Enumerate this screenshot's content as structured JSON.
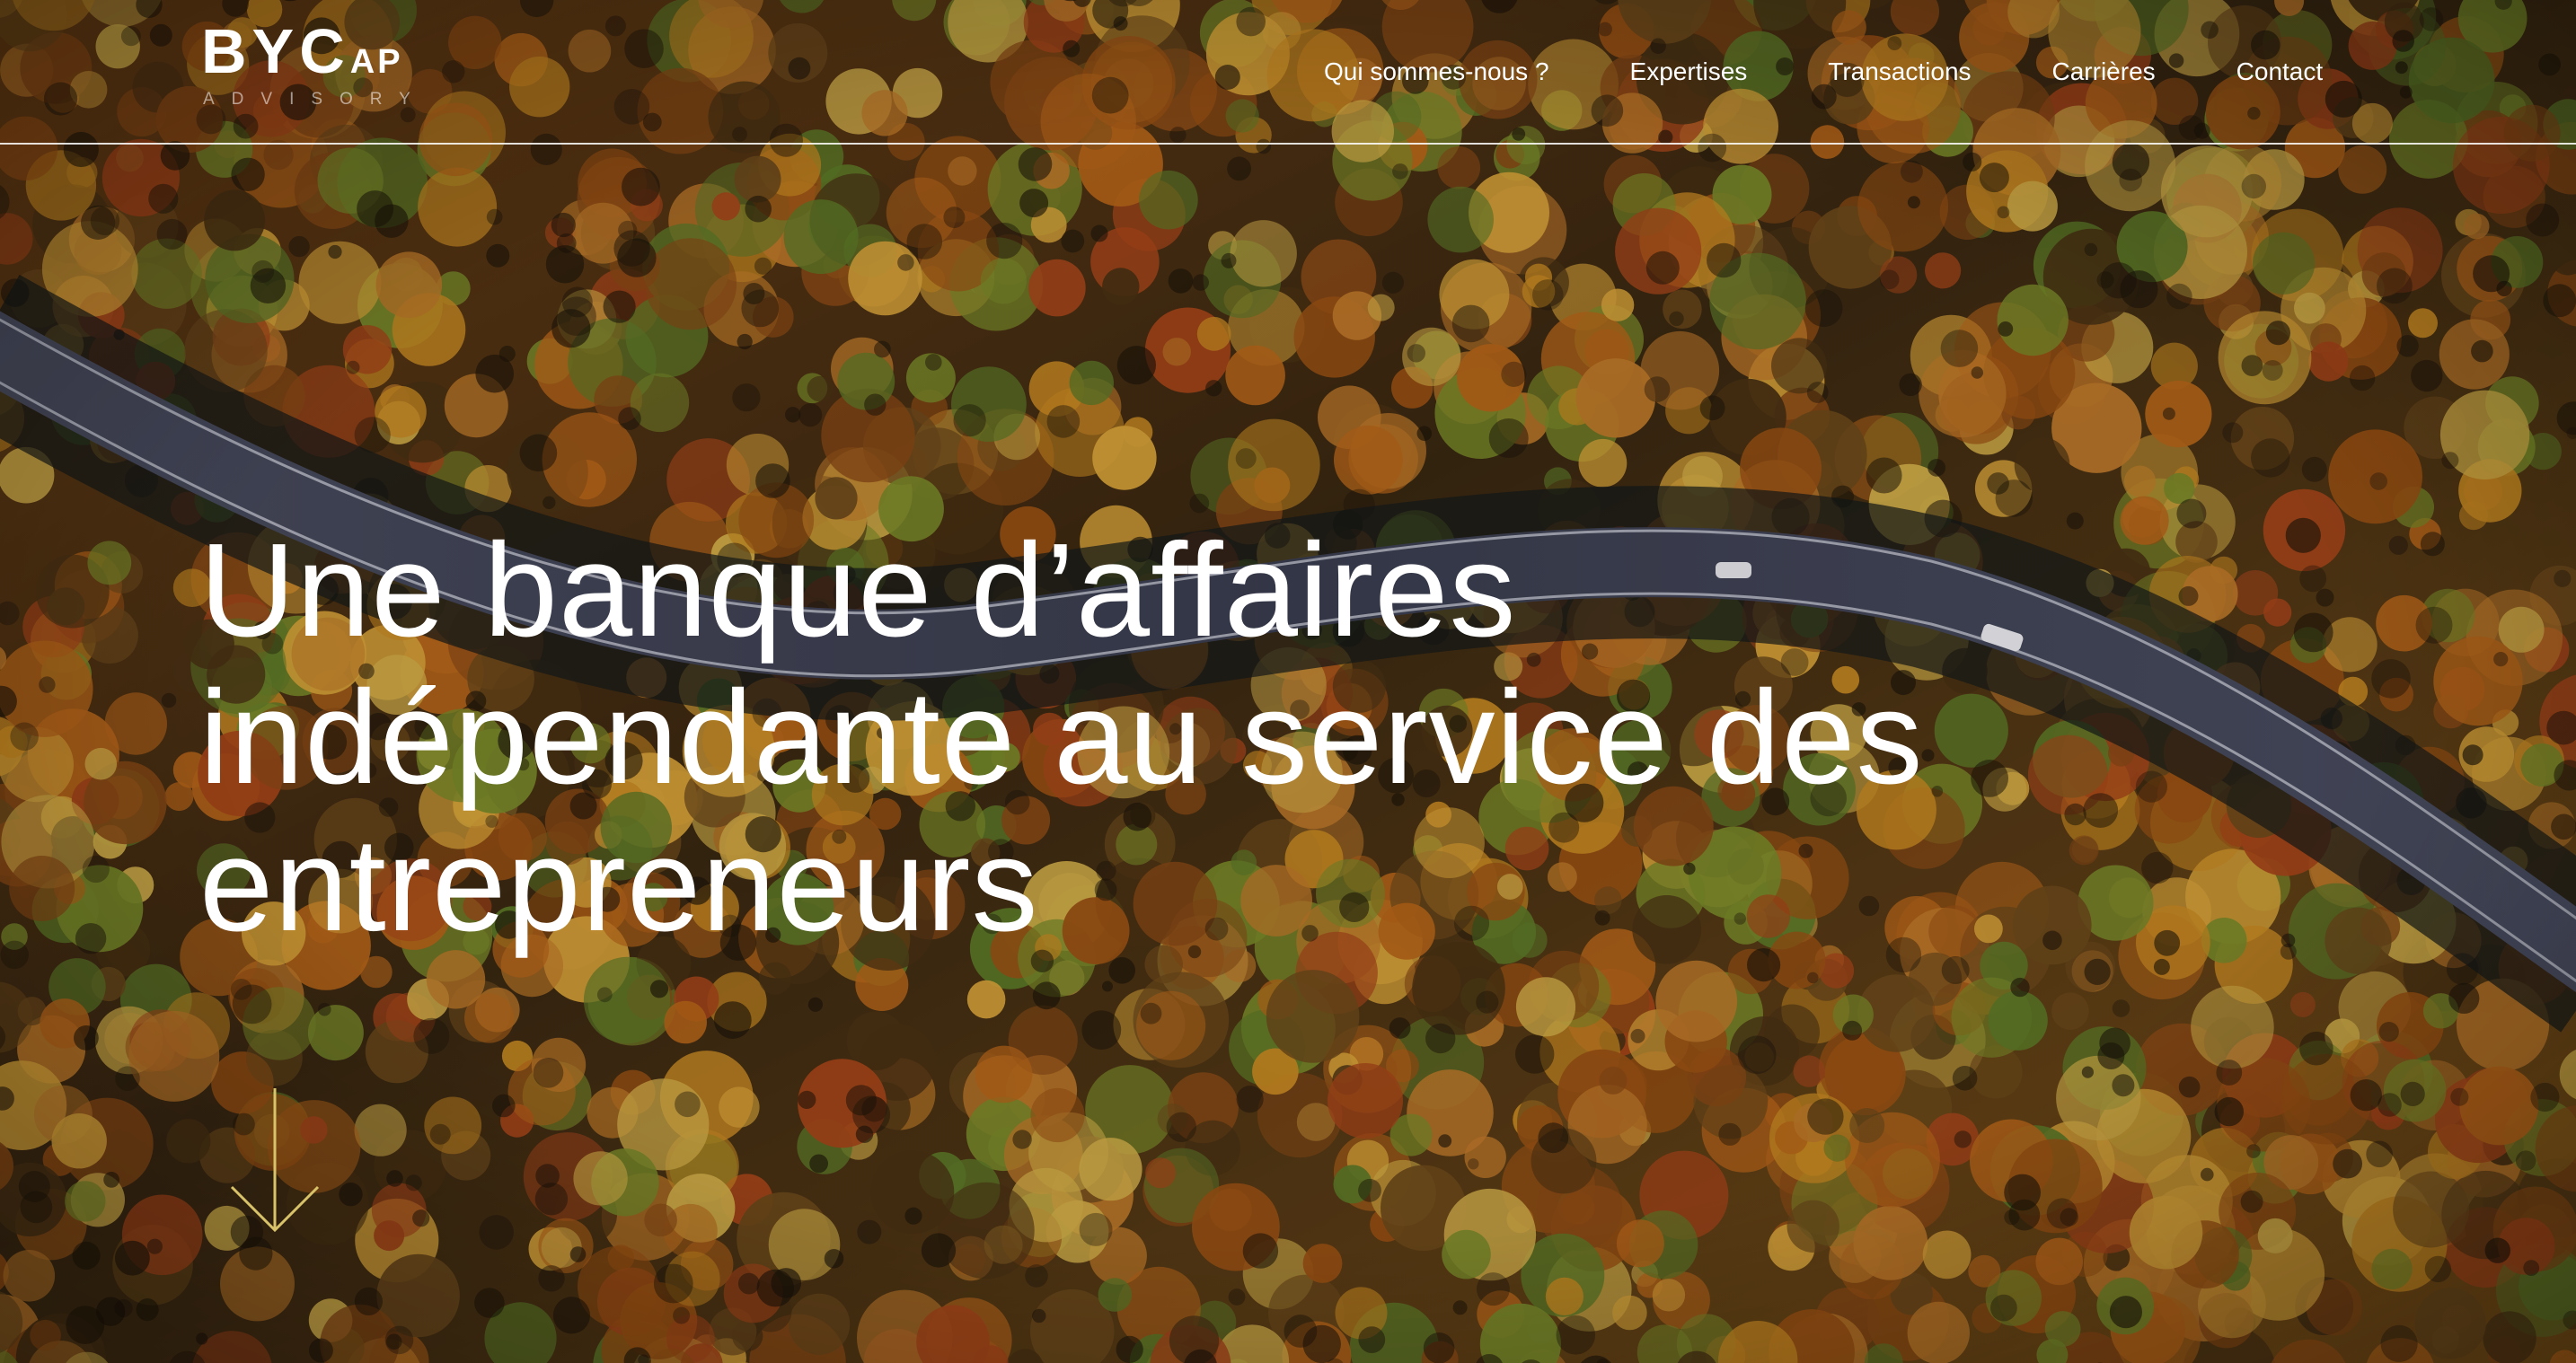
{
  "brand": {
    "logo_main": "BYC",
    "logo_suffix": "AP",
    "logo_sub": "ADVISORY"
  },
  "nav": {
    "items": [
      {
        "label": "Qui sommes-nous ?"
      },
      {
        "label": "Expertises"
      },
      {
        "label": "Transactions"
      },
      {
        "label": "Carrières"
      },
      {
        "label": "Contact"
      }
    ]
  },
  "hero": {
    "title_lines": [
      "Une banque d’affaires",
      "indépendante au service des",
      "entrepreneurs"
    ],
    "background": "aerial-autumn-forest-road-photo"
  },
  "icons": {
    "scroll": "arrow-down-icon"
  },
  "colors": {
    "text": "#ffffff",
    "forest_orange": "#b86a1c",
    "forest_gold": "#c9921f",
    "forest_green": "#6e8a2c",
    "forest_dark": "#2a1d10",
    "road": "#3d4050",
    "scroll_arrow": "#d8c36a"
  }
}
